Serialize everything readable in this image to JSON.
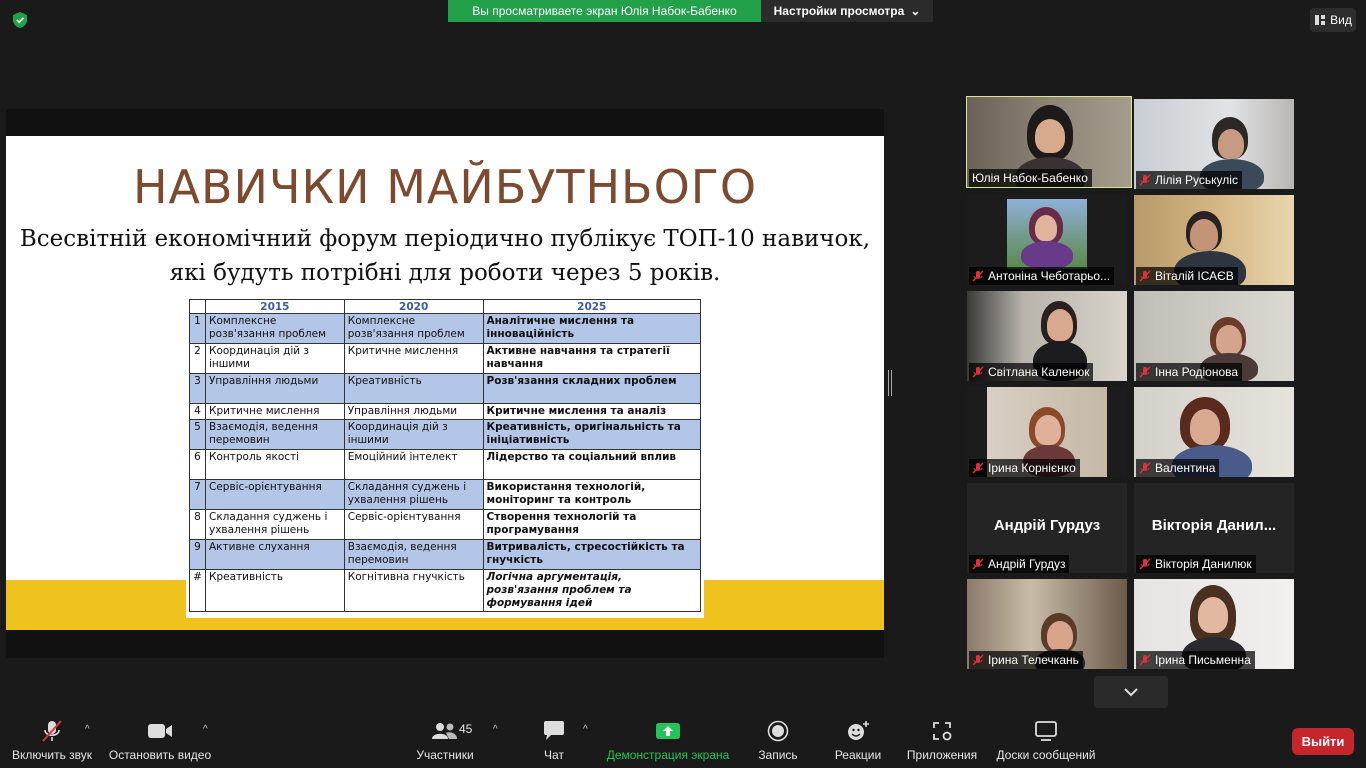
{
  "top": {
    "sharing_banner": "Вы просматриваете экран Юлія Набок-Бабенко",
    "view_settings": "Настройки просмотра",
    "view_button": "Вид"
  },
  "slide": {
    "title": "НАВИЧКИ МАЙБУТНЬОГО",
    "subtitle_line1": "Всесвітній економічний форум періодично публікує ТОП-10 навичок,",
    "subtitle_line2": "які будуть потрібні для роботи через 5 років.",
    "table": {
      "headers": [
        "2015",
        "2020",
        "2025"
      ],
      "rows": [
        {
          "n": "1",
          "c1": "Комплексне розв'язання проблем",
          "c2": "Комплексне розв'язання проблем",
          "c3": "Аналітичне мислення та інноваційність"
        },
        {
          "n": "2",
          "c1": "Координація дій з іншими",
          "c2": "Критичне мислення",
          "c3": "Активне навчання та стратегії навчання"
        },
        {
          "n": "3",
          "c1": "Управління людьми",
          "c2": "Креативність",
          "c3": "Розв'язання складних проблем"
        },
        {
          "n": "4",
          "c1": "Критичне мислення",
          "c2": "Управління людьми",
          "c3": "Критичне мислення та аналіз"
        },
        {
          "n": "5",
          "c1": "Взаємодія, ведення перемовин",
          "c2": "Координація дій з іншими",
          "c3": "Креативність, оригінальність та ініціативність"
        },
        {
          "n": "6",
          "c1": "Контроль якості",
          "c2": "Емоційний інтелект",
          "c3": "Лідерство та соціальний вплив"
        },
        {
          "n": "7",
          "c1": "Сервіс-орієнтування",
          "c2": "Складання суджень і ухвалення рішень",
          "c3": "Використання технологій, моніторинг та контроль"
        },
        {
          "n": "8",
          "c1": "Складання суджень і ухвалення рішень",
          "c2": "Сервіс-орієнтування",
          "c3": "Створення технологій та програмування"
        },
        {
          "n": "9",
          "c1": "Активне слухання",
          "c2": "Взаємодія, ведення перемовин",
          "c3": "Витривалість, стресостійкість та гнучкість"
        },
        {
          "n": "#",
          "c1": "Креативність",
          "c2": "Когнітивна гнучкість",
          "c3": "Логічна аргументація, розв'язання проблем та формування ідей"
        }
      ]
    }
  },
  "participants": [
    "Юлія Набок-Бабенко",
    "Лілія Руськуліс",
    "Антоніна Чеботарьо...",
    "Віталій ІСАЄВ",
    "Світлана Каленюк",
    "Інна Родіонова",
    "Ірина Корнієнко",
    "Валентина",
    "Андрій Гурдуз",
    "Вікторія Данилюк",
    "Ірина Телечкань",
    "Ірина Письменна"
  ],
  "no_video_titles": {
    "andrii": "Андрій Гурдуз",
    "viktoria": "Вікторія Данил..."
  },
  "toolbar": {
    "unmute": "Включить звук",
    "stop_video": "Остановить видео",
    "participants": "Участники",
    "participants_count": "45",
    "chat": "Чат",
    "share_screen": "Демонстрация экрана",
    "record": "Запись",
    "reactions": "Реакции",
    "apps": "Приложения",
    "whiteboards": "Доски сообщений",
    "leave": "Выйти"
  },
  "colors": {
    "share_green": "#23a04a",
    "leave_red": "#c6252b",
    "slide_title": "#7d4a2f",
    "slide_band": "#f0c21d",
    "table_highlight": "#b4c6e7",
    "active_speaker": "#d6e68a"
  }
}
